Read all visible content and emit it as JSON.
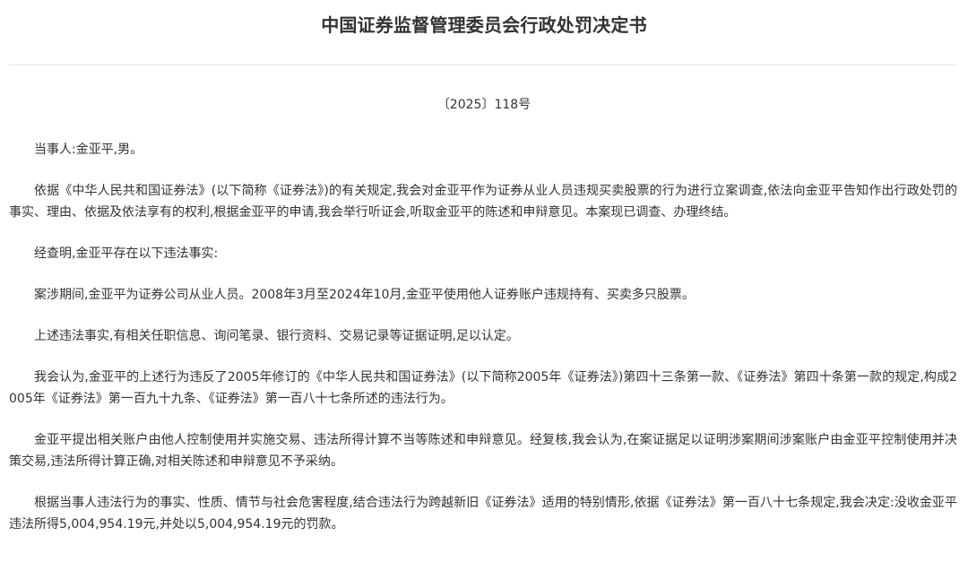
{
  "document": {
    "title": "中国证券监督管理委员会行政处罚决定书",
    "number": "〔2025〕118号",
    "paragraphs": [
      "当事人:金亚平,男。",
      "依据《中华人民共和国证券法》(以下简称《证券法》)的有关规定,我会对金亚平作为证券从业人员违规买卖股票的行为进行立案调查,依法向金亚平告知作出行政处罚的事实、理由、依据及依法享有的权利,根据金亚平的申请,我会举行听证会,听取金亚平的陈述和申辩意见。本案现已调查、办理终结。",
      "经查明,金亚平存在以下违法事实:",
      "案涉期间,金亚平为证券公司从业人员。2008年3月至2024年10月,金亚平使用他人证券账户违规持有、买卖多只股票。",
      "上述违法事实,有相关任职信息、询问笔录、银行资料、交易记录等证据证明,足以认定。",
      "我会认为,金亚平的上述行为违反了2005年修订的《中华人民共和国证券法》(以下简称2005年《证券法》)第四十三条第一款、《证券法》第四十条第一款的规定,构成2005年《证券法》第一百九十九条、《证券法》第一百八十七条所述的违法行为。",
      "金亚平提出相关账户由他人控制使用并实施交易、违法所得计算不当等陈述和申辩意见。经复核,我会认为,在案证据足以证明涉案期间涉案账户由金亚平控制使用并决策交易,违法所得计算正确,对相关陈述和申辩意见不予采纳。",
      "根据当事人违法行为的事实、性质、情节与社会危害程度,结合违法行为跨越新旧《证券法》适用的特别情形,依据《证券法》第一百八十七条规定,我会决定:没收金亚平违法所得5,004,954.19元,并处以5,004,954.19元的罚款。"
    ]
  }
}
